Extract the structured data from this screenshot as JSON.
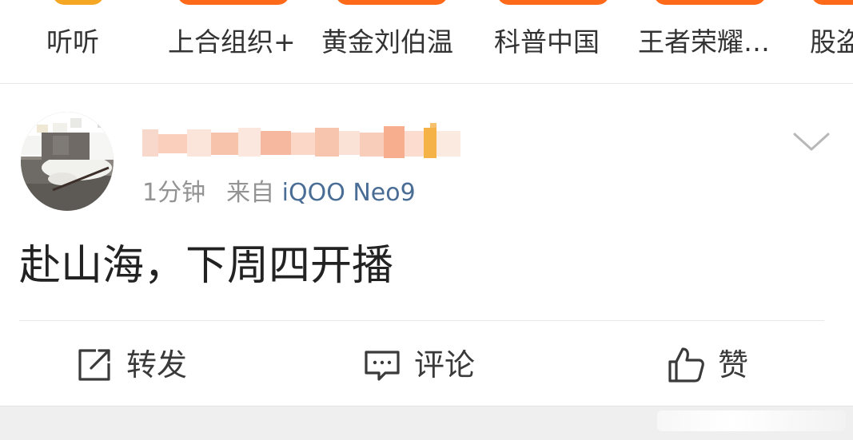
{
  "topics": [
    {
      "label": "听听"
    },
    {
      "label": "上合组织+"
    },
    {
      "label": "黄金刘伯温"
    },
    {
      "label": "科普中国"
    },
    {
      "label": "王者荣耀…"
    },
    {
      "label": "股盗"
    }
  ],
  "post": {
    "time": "1分钟",
    "source_prefix": "来自",
    "device": "iQOO Neo9",
    "text": "赴山海，下周四开播"
  },
  "actions": {
    "repost": "转发",
    "comment": "评论",
    "like": "赞"
  },
  "colors": {
    "accent": "#ff6a1a",
    "device_link": "#4a6d95",
    "muted": "#939393"
  }
}
